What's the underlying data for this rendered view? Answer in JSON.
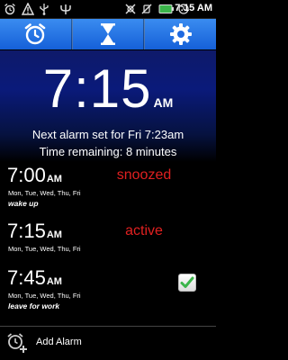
{
  "status_bar": {
    "time": "7:15",
    "ampm": "AM",
    "icons": [
      "alarm-icon",
      "warning-icon",
      "usb-icon",
      "psi-icon",
      "wifi-icon",
      "signal-icon",
      "battery-icon",
      "clock-icon"
    ]
  },
  "toolbar": {
    "buttons": [
      {
        "name": "alarm-clock-icon"
      },
      {
        "name": "hourglass-icon"
      },
      {
        "name": "settings-gear-icon"
      }
    ]
  },
  "clock": {
    "time": "7:15",
    "ampm": "AM"
  },
  "next_alarm": {
    "line1": "Next alarm set for Fri 7:23am",
    "line2": "Time remaining: 8 minutes"
  },
  "alarms": [
    {
      "time": "7:00",
      "ampm": "AM",
      "days": "Mon, Tue, Wed, Thu, Fri",
      "label": "wake up",
      "status": "snoozed",
      "status_color": "#e02020",
      "checked": false
    },
    {
      "time": "7:15",
      "ampm": "AM",
      "days": "Mon, Tue, Wed, Thu, Fri",
      "label": "",
      "status": "active",
      "status_color": "#e02020",
      "checked": false
    },
    {
      "time": "7:45",
      "ampm": "AM",
      "days": "Mon, Tue, Wed, Thu, Fri",
      "label": "leave for work",
      "status": "",
      "status_color": "#e02020",
      "checked": true
    }
  ],
  "add_alarm": {
    "label": "Add Alarm"
  },
  "colors": {
    "toolbar": "#2a7ae6",
    "status_text": "#e02020",
    "check": "#3bb54a"
  }
}
